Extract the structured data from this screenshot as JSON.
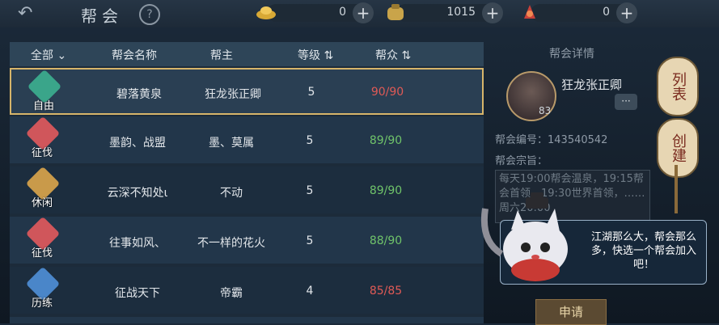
{
  "header": {
    "back_icon": "back-arrow-icon",
    "title": "帮会",
    "help_label": "?",
    "resources": [
      {
        "name": "ingot",
        "icon": "gold-ingot-icon",
        "value": "0"
      },
      {
        "name": "silver",
        "icon": "silver-pouch-icon",
        "value": "1015"
      },
      {
        "name": "token",
        "icon": "red-token-icon",
        "value": "0"
      }
    ]
  },
  "table": {
    "headers": {
      "filter": "全部",
      "name": "帮会名称",
      "leader": "帮主",
      "level": "等级",
      "members": "帮众"
    },
    "rows": [
      {
        "tag": "自由",
        "tag_color": "#3aa58a",
        "name": "碧落黄泉",
        "leader": "狂龙张正卿",
        "level": "5",
        "members": "90/90",
        "selected": true
      },
      {
        "tag": "征伐",
        "tag_color": "#d0565b",
        "name": "墨韵、战盟",
        "leader": "墨、莫属",
        "level": "5",
        "members": "89/90"
      },
      {
        "tag": "休闲",
        "tag_color": "#c99a4a",
        "name": "云深不知处ι",
        "leader": "不动",
        "level": "5",
        "members": "89/90"
      },
      {
        "tag": "征伐",
        "tag_color": "#d0565b",
        "name": "往事如风、",
        "leader": "不一样的花火",
        "level": "5",
        "members": "88/90"
      },
      {
        "tag": "历练",
        "tag_color": "#4a86c9",
        "name": "征战天下",
        "leader": "帝霸",
        "level": "4",
        "members": "85/85"
      }
    ]
  },
  "detail": {
    "title": "帮会详情",
    "leader_name": "狂龙张正卿",
    "leader_level": "83",
    "guild_id_label": "帮会编号：",
    "guild_id": "143540542",
    "purpose_label": "帮会宗旨：",
    "purpose_text": "每天19:00帮会温泉，19:15帮会首领，19:30世界首领，……周六20:00",
    "apply_label": "申请"
  },
  "side_buttons": {
    "list": "列表",
    "create": "创建"
  },
  "bubble": {
    "text": "江湖那么大，帮会那么多，快选一个帮会加入吧！"
  }
}
